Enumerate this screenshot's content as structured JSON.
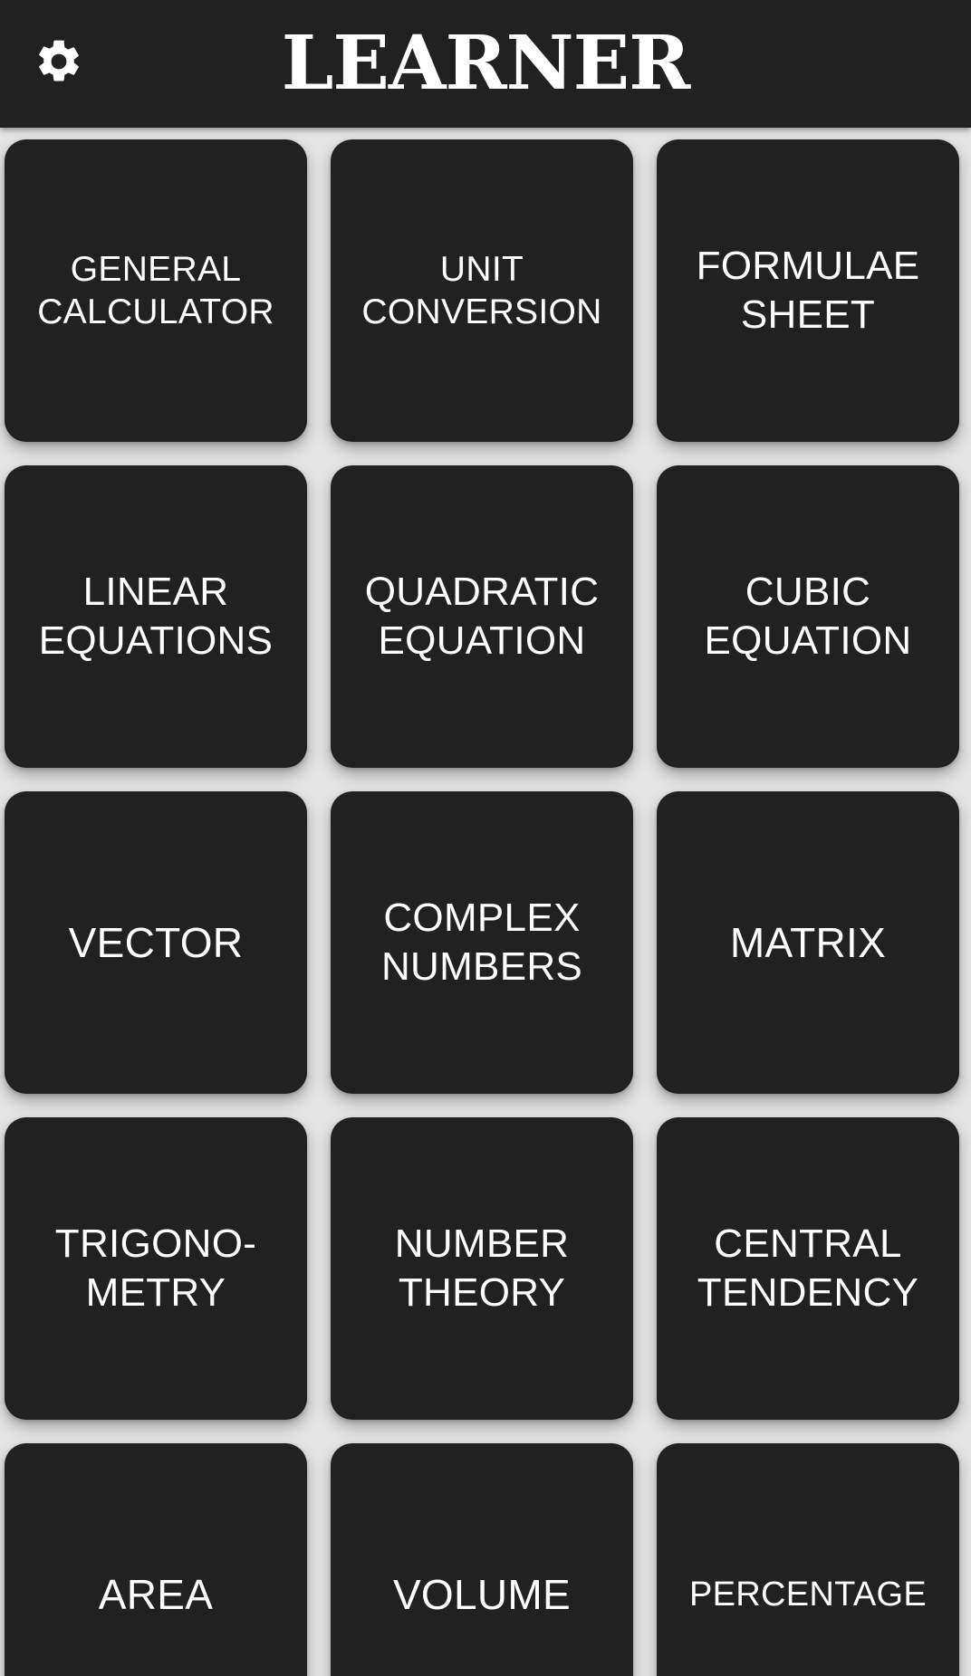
{
  "header": {
    "title": "LEARNER",
    "settings_icon": "gear-icon"
  },
  "tiles": [
    {
      "id": "general-calculator",
      "label": "GENERAL\nCALCULATOR"
    },
    {
      "id": "unit-conversion",
      "label": "UNIT\nCONVERSION"
    },
    {
      "id": "formulae-sheet",
      "label": "FORMULAE\nSHEET"
    },
    {
      "id": "linear-equations",
      "label": "LINEAR\nEQUATIONS"
    },
    {
      "id": "quadratic-equation",
      "label": "QUADRATIC\nEQUATION"
    },
    {
      "id": "cubic-equation",
      "label": "CUBIC\nEQUATION"
    },
    {
      "id": "vector",
      "label": "VECTOR"
    },
    {
      "id": "complex-numbers",
      "label": "COMPLEX\nNUMBERS"
    },
    {
      "id": "matrix",
      "label": "MATRIX"
    },
    {
      "id": "trigonometry",
      "label": "TRIGONO-\nMETRY"
    },
    {
      "id": "number-theory",
      "label": "NUMBER\nTHEORY"
    },
    {
      "id": "central-tendency",
      "label": "CENTRAL\nTENDENCY"
    },
    {
      "id": "area",
      "label": "AREA"
    },
    {
      "id": "volume",
      "label": "VOLUME"
    },
    {
      "id": "percentage",
      "label": "PERCENTAGE"
    }
  ],
  "colors": {
    "topbar": "#212121",
    "tile": "#212121",
    "background": "#e4e4e4",
    "text": "#ffffff"
  }
}
